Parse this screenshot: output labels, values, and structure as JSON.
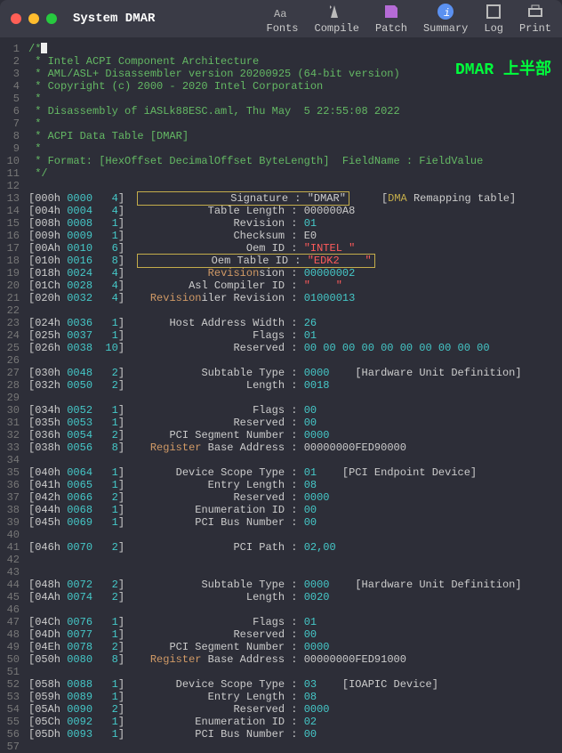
{
  "title": "System DMAR",
  "toolbar": {
    "fonts": "Fonts",
    "compile": "Compile",
    "patch": "Patch",
    "summary": "Summary",
    "log": "Log",
    "print": "Print"
  },
  "badge": "DMAR 上半部",
  "comment": [
    "/*",
    " * Intel ACPI Component Architecture",
    " * AML/ASL+ Disassembler version 20200925 (64-bit version)",
    " * Copyright (c) 2000 - 2020 Intel Corporation",
    " * ",
    " * Disassembly of iASLk88ESC.aml, Thu May  5 22:55:08 2022",
    " *",
    " * ACPI Data Table [DMAR]",
    " *",
    " * Format: [HexOffset DecimalOffset ByteLength]  FieldName : FieldValue",
    " */"
  ],
  "lines": [
    {
      "n": 13,
      "h": "000h",
      "d": "0000",
      "b": "4",
      "f": "Signature :",
      "v": "\"DMAR\"",
      "note": "[DMA Remapping table]",
      "hl": "both"
    },
    {
      "n": 14,
      "h": "004h",
      "d": "0004",
      "b": "4",
      "f": "Table Length :",
      "v": "000000A8"
    },
    {
      "n": 15,
      "h": "008h",
      "d": "0008",
      "b": "1",
      "f": "Revision :",
      "v": "01",
      "vc": "cyan"
    },
    {
      "n": 16,
      "h": "009h",
      "d": "0009",
      "b": "1",
      "f": "Checksum :",
      "v": "E0"
    },
    {
      "n": 17,
      "h": "00Ah",
      "d": "0010",
      "b": "6",
      "f": "Oem ID :",
      "v": "\"INTEL \"",
      "vc": "red"
    },
    {
      "n": 18,
      "h": "010h",
      "d": "0016",
      "b": "8",
      "f": "Oem Table ID :",
      "v": "\"EDK2    \"",
      "vc": "red",
      "hl": "both"
    },
    {
      "n": 19,
      "h": "018h",
      "d": "0024",
      "b": "4",
      "f": "Oem Revision :",
      "v": "00000002",
      "vc": "cyan",
      "key": "Revision"
    },
    {
      "n": 20,
      "h": "01Ch",
      "d": "0028",
      "b": "4",
      "f": "Asl Compiler ID :",
      "v": "\"    \"",
      "vc": "red"
    },
    {
      "n": 21,
      "h": "020h",
      "d": "0032",
      "b": "4",
      "f": "Asl Compiler Revision :",
      "v": "01000013",
      "vc": "cyan",
      "key": "Revision"
    },
    {
      "n": 22
    },
    {
      "n": 23,
      "h": "024h",
      "d": "0036",
      "b": "1",
      "f": "Host Address Width :",
      "v": "26",
      "vc": "cyan"
    },
    {
      "n": 24,
      "h": "025h",
      "d": "0037",
      "b": "1",
      "f": "Flags :",
      "v": "01",
      "vc": "cyan"
    },
    {
      "n": 25,
      "h": "026h",
      "d": "0038",
      "b": "10",
      "f": "Reserved :",
      "v": "00 00 00 00 00 00 00 00 00 00",
      "vc": "cyan"
    },
    {
      "n": 26
    },
    {
      "n": 27,
      "h": "030h",
      "d": "0048",
      "b": "2",
      "f": "Subtable Type :",
      "v": "0000",
      "note": "[Hardware Unit Definition]",
      "vc": "cyan"
    },
    {
      "n": 28,
      "h": "032h",
      "d": "0050",
      "b": "2",
      "f": "Length :",
      "v": "0018",
      "vc": "cyan"
    },
    {
      "n": 29
    },
    {
      "n": 30,
      "h": "034h",
      "d": "0052",
      "b": "1",
      "f": "Flags :",
      "v": "00",
      "vc": "cyan"
    },
    {
      "n": 31,
      "h": "035h",
      "d": "0053",
      "b": "1",
      "f": "Reserved :",
      "v": "00",
      "vc": "cyan"
    },
    {
      "n": 32,
      "h": "036h",
      "d": "0054",
      "b": "2",
      "f": "PCI Segment Number :",
      "v": "0000",
      "vc": "cyan"
    },
    {
      "n": 33,
      "h": "038h",
      "d": "0056",
      "b": "8",
      "f": "Register Base Address :",
      "v": "00000000FED90000",
      "key": "Register"
    },
    {
      "n": 34
    },
    {
      "n": 35,
      "h": "040h",
      "d": "0064",
      "b": "1",
      "f": "Device Scope Type :",
      "v": "01",
      "note": "[PCI Endpoint Device]",
      "vc": "cyan"
    },
    {
      "n": 36,
      "h": "041h",
      "d": "0065",
      "b": "1",
      "f": "Entry Length :",
      "v": "08",
      "vc": "cyan"
    },
    {
      "n": 37,
      "h": "042h",
      "d": "0066",
      "b": "2",
      "f": "Reserved :",
      "v": "0000",
      "vc": "cyan"
    },
    {
      "n": 38,
      "h": "044h",
      "d": "0068",
      "b": "1",
      "f": "Enumeration ID :",
      "v": "00",
      "vc": "cyan"
    },
    {
      "n": 39,
      "h": "045h",
      "d": "0069",
      "b": "1",
      "f": "PCI Bus Number :",
      "v": "00",
      "vc": "cyan"
    },
    {
      "n": 40
    },
    {
      "n": 41,
      "h": "046h",
      "d": "0070",
      "b": "2",
      "f": "PCI Path :",
      "v": "02,00",
      "vc": "cyan"
    },
    {
      "n": 42
    },
    {
      "n": 43
    },
    {
      "n": 44,
      "h": "048h",
      "d": "0072",
      "b": "2",
      "f": "Subtable Type :",
      "v": "0000",
      "note": "[Hardware Unit Definition]",
      "vc": "cyan"
    },
    {
      "n": 45,
      "h": "04Ah",
      "d": "0074",
      "b": "2",
      "f": "Length :",
      "v": "0020",
      "vc": "cyan"
    },
    {
      "n": 46
    },
    {
      "n": 47,
      "h": "04Ch",
      "d": "0076",
      "b": "1",
      "f": "Flags :",
      "v": "01",
      "vc": "cyan"
    },
    {
      "n": 48,
      "h": "04Dh",
      "d": "0077",
      "b": "1",
      "f": "Reserved :",
      "v": "00",
      "vc": "cyan"
    },
    {
      "n": 49,
      "h": "04Eh",
      "d": "0078",
      "b": "2",
      "f": "PCI Segment Number :",
      "v": "0000",
      "vc": "cyan"
    },
    {
      "n": 50,
      "h": "050h",
      "d": "0080",
      "b": "8",
      "f": "Register Base Address :",
      "v": "00000000FED91000",
      "key": "Register"
    },
    {
      "n": 51
    },
    {
      "n": 52,
      "h": "058h",
      "d": "0088",
      "b": "1",
      "f": "Device Scope Type :",
      "v": "03",
      "note": "[IOAPIC Device]",
      "vc": "cyan"
    },
    {
      "n": 53,
      "h": "059h",
      "d": "0089",
      "b": "1",
      "f": "Entry Length :",
      "v": "08",
      "vc": "cyan"
    },
    {
      "n": 54,
      "h": "05Ah",
      "d": "0090",
      "b": "2",
      "f": "Reserved :",
      "v": "0000",
      "vc": "cyan"
    },
    {
      "n": 55,
      "h": "05Ch",
      "d": "0092",
      "b": "1",
      "f": "Enumeration ID :",
      "v": "02",
      "vc": "cyan"
    },
    {
      "n": 56,
      "h": "05Dh",
      "d": "0093",
      "b": "1",
      "f": "PCI Bus Number :",
      "v": "00",
      "vc": "cyan"
    },
    {
      "n": 57
    }
  ]
}
